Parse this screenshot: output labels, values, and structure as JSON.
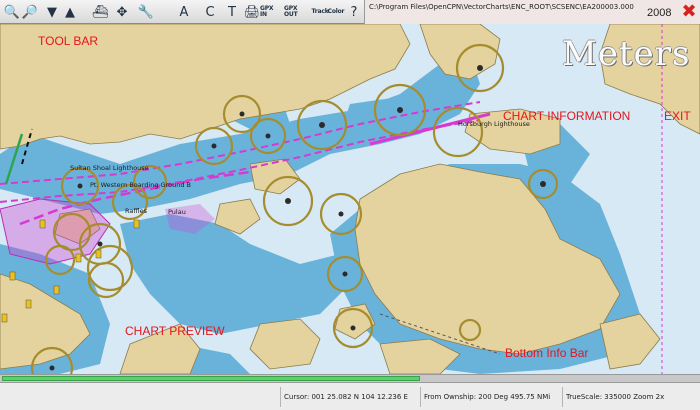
{
  "toolbar": {
    "buttons": [
      {
        "name": "zoom-in-icon",
        "glyph": "🔍"
      },
      {
        "name": "zoom-out-icon",
        "glyph": "🔎"
      },
      {
        "name": "quilt-down-icon",
        "glyph": "▼"
      },
      {
        "name": "quilt-up-icon",
        "glyph": "▲"
      },
      {
        "name": "follow-ship-icon",
        "glyph": "⛴"
      },
      {
        "name": "center-pan-icon",
        "glyph": "✥"
      },
      {
        "name": "settings-icon",
        "glyph": "🔧"
      },
      {
        "name": "text-icon",
        "glyph": "A"
      },
      {
        "name": "current-icon",
        "glyph": "C"
      },
      {
        "name": "tide-icon",
        "glyph": "T"
      },
      {
        "name": "print-icon",
        "glyph": "🖨"
      },
      {
        "name": "gpx-in-icon",
        "glyph": "GPX IN"
      },
      {
        "name": "gpx-out-icon",
        "glyph": "GPX OUT"
      },
      {
        "name": "track-icon",
        "glyph": "Track"
      },
      {
        "name": "color-icon",
        "glyph": "Color"
      },
      {
        "name": "help-icon",
        "glyph": "?"
      }
    ]
  },
  "chart_info": {
    "path": "C:\\Program Files\\OpenCPN\\VectorCharts\\ENC_ROOT\\SCSENC\\EA200003.000",
    "year": "2008",
    "exit_glyph": "✖"
  },
  "units_label": "Meters",
  "chart_labels": {
    "sultan_shoal": "Sultan Shoal Lighthouse",
    "boarding_ground": "Pt. Western Boarding Ground B",
    "raffles": "Raffles",
    "horsburgh": "Horsburgh Lighthouse",
    "pulau": "Pulau"
  },
  "annotations": {
    "tool_bar": "TOOL BAR",
    "chart_information": "CHART INFORMATION",
    "exit": "EXIT",
    "chart_preview": "CHART PREVIEW",
    "bottom_info_bar": "Bottom Info Bar"
  },
  "chart_preview": {
    "fill_fraction": 0.6
  },
  "status_bar": {
    "cursor": "Cursor: 001 25.082 N 104 12.236 E",
    "from_ownship": "From Ownship: 200 Deg  495.75 NMi",
    "truescale": "TrueScale:  335000  Zoom    2x"
  },
  "colors": {
    "annotation_red": "#e3161b",
    "land": "#e4d29f",
    "shallow_water": "#69b3db",
    "deep_water": "#d8ecf6",
    "route_magenta": "#d53ad1",
    "preview_green": "#5bd16a"
  }
}
